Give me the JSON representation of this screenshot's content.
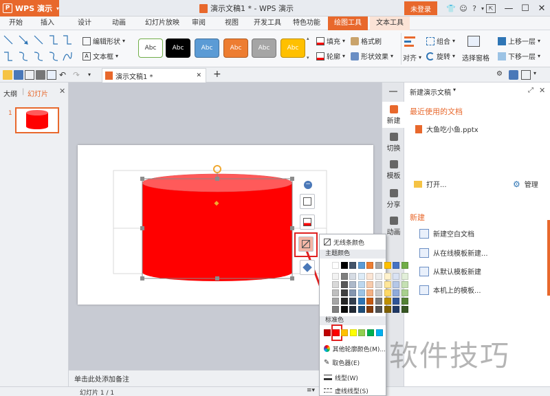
{
  "titlebar": {
    "app_name": "WPS 演示",
    "doc_title": "演示文稿1 * - WPS 演示",
    "login_label": "未登录",
    "icons": [
      "shirt-icon",
      "skin-icon",
      "help-icon",
      "chevron-down-icon",
      "export-icon",
      "minimize-icon",
      "maximize-icon",
      "close-icon"
    ]
  },
  "menu": {
    "tabs": [
      "开始",
      "插入",
      "设计",
      "动画",
      "幻灯片放映",
      "审阅",
      "视图",
      "开发工具",
      "特色功能",
      "绘图工具",
      "文本工具"
    ],
    "active_tab": "绘图工具"
  },
  "ribbon": {
    "edit_shape": "编辑形状",
    "text_box": "文本框",
    "styles": [
      {
        "label": "Abc",
        "bg": "#ffffff",
        "fg": "#333333",
        "border": "#70ad47"
      },
      {
        "label": "Abc",
        "bg": "#000000",
        "fg": "#ffffff",
        "border": "#000000"
      },
      {
        "label": "Abc",
        "bg": "#5b9bd5",
        "fg": "#ffffff",
        "border": "#41719c"
      },
      {
        "label": "Abc",
        "bg": "#ed7d31",
        "fg": "#ffffff",
        "border": "#ae5a21"
      },
      {
        "label": "Abc",
        "bg": "#a5a5a5",
        "fg": "#ffffff",
        "border": "#787878"
      },
      {
        "label": "Abc",
        "bg": "#ffc000",
        "fg": "#ffffff",
        "border": "#bc8c00"
      }
    ],
    "fill": "填充",
    "format_brush": "格式刷",
    "outline": "轮廓",
    "shape_effect": "形状效果",
    "align": "对齐",
    "group": "组合",
    "rotate": "旋转",
    "selection_pane": "选择窗格",
    "bring_forward": "上移一层",
    "send_backward": "下移一层"
  },
  "quickbar": {
    "doc_tab": "演示文稿1 *",
    "add_tab": "+"
  },
  "leftpane": {
    "tab_outline": "大纲",
    "tab_slides": "幻灯片",
    "slide_number": "1"
  },
  "notes_placeholder": "单击此处添加备注",
  "status": {
    "slide_counter": "幻灯片 1 / 1"
  },
  "shape": {
    "fill_color": "#ff0000",
    "top_color": "#ff5a5a"
  },
  "sidetabs": [
    "新建",
    "切换",
    "模板",
    "分享",
    "动画"
  ],
  "taskpane": {
    "title": "新建演示文稿",
    "recent_heading": "最近使用的文档",
    "recent_file": "大鱼吃小鱼.pptx",
    "open_label": "打开...",
    "manage_label": "管理",
    "new_heading": "新建",
    "new_items": [
      "新建空白文档",
      "从在线模板新建...",
      "从默认模板新建",
      "本机上的模板..."
    ]
  },
  "dropdown": {
    "no_line": "无线条颜色",
    "theme_colors": "主题颜色",
    "theme_top": [
      "#ffffff",
      "#000000",
      "#44546a",
      "#5b9bd5",
      "#ed7d31",
      "#a5a5a5",
      "#ffc000",
      "#4472c4",
      "#70ad47"
    ],
    "theme_cols": [
      [
        "#f2f2f2",
        "#d9d9d9",
        "#bfbfbf",
        "#a6a6a6",
        "#808080"
      ],
      [
        "#7f7f7f",
        "#595959",
        "#404040",
        "#262626",
        "#0d0d0d"
      ],
      [
        "#d6dce4",
        "#adb9ca",
        "#8496b0",
        "#333f4f",
        "#222a35"
      ],
      [
        "#ddebf7",
        "#bdd7ee",
        "#9cc3e5",
        "#2e75b5",
        "#1f4e79"
      ],
      [
        "#fbe5d5",
        "#f7cbac",
        "#f4b183",
        "#c55a11",
        "#833c0b"
      ],
      [
        "#ededed",
        "#dbdbdb",
        "#c9c9c9",
        "#7b7b7b",
        "#525252"
      ],
      [
        "#fff2cc",
        "#ffe699",
        "#ffd966",
        "#bf9000",
        "#7f6000"
      ],
      [
        "#d9e2f3",
        "#b4c7e7",
        "#8eaadb",
        "#2f5496",
        "#1f3864"
      ],
      [
        "#e2efd9",
        "#c5e0b3",
        "#a8d08d",
        "#538135",
        "#375623"
      ]
    ],
    "standard_colors": "标准色",
    "standard": [
      "#c00000",
      "#ff0000",
      "#ffc000",
      "#ffff00",
      "#92d050",
      "#00b050",
      "#00b0f0"
    ],
    "more_colors": "其他轮廓颜色(M)...",
    "eyedropper": "取色器(E)",
    "line_style": "线型(W)",
    "dash_style": "虚线线型(S)"
  },
  "watermark": "软件技巧"
}
